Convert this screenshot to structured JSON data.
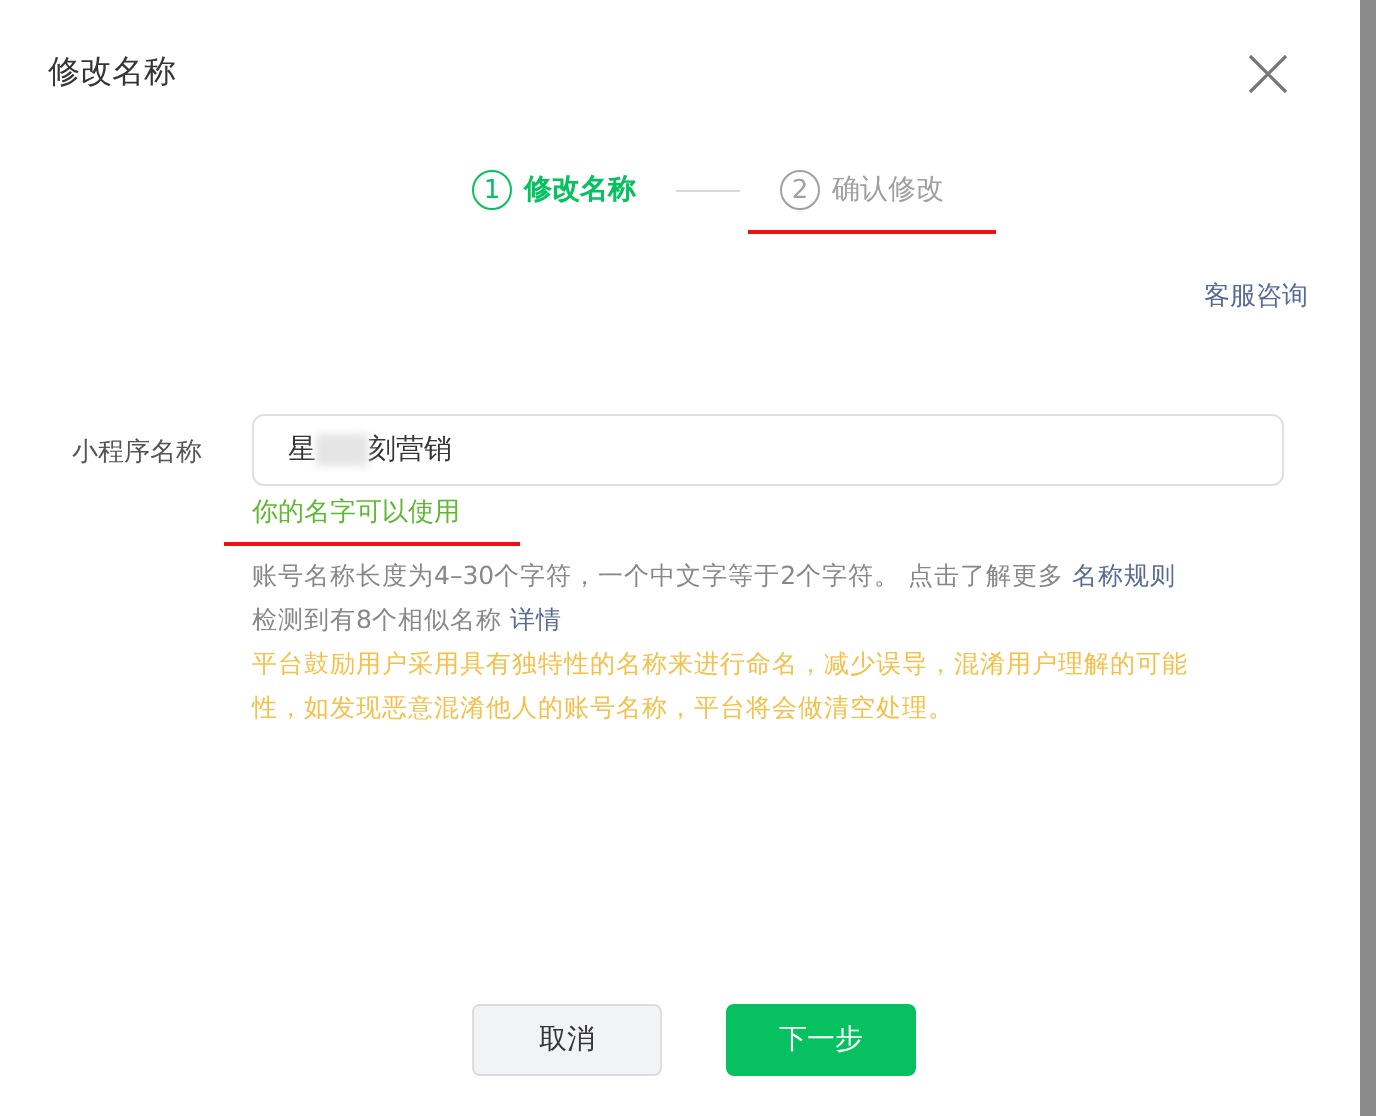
{
  "dialog": {
    "title": "修改名称",
    "closable": true
  },
  "steps": [
    {
      "number": "1",
      "label": "修改名称",
      "selected": true,
      "underlined": false
    },
    {
      "number": "2",
      "label": "确认修改",
      "selected": false,
      "underlined": true
    }
  ],
  "support_link": "客服咨询",
  "form": {
    "label": "小程序名称",
    "value_before_redaction": "星",
    "redacted": true,
    "value_after_redaction": "刻营销",
    "status": {
      "text": "你的名字可以使用",
      "underlined": true
    },
    "rule_text": "账号名称长度为4–30个字符，一个中文字等于2个字符。 点击了解更多",
    "rule_link": "名称规则",
    "similar_text": "检测到有8个相似名称",
    "similar_link": "详情",
    "warning": "平台鼓励用户采用具有独特性的名称来进行命名，减少误导，混淆用户理解的可能性，如发现恶意混淆他人的账号名称，平台将会做清空处理。"
  },
  "buttons": [
    {
      "label": "取消",
      "kind": "secondary"
    },
    {
      "label": "下一步",
      "kind": "primary"
    }
  ]
}
